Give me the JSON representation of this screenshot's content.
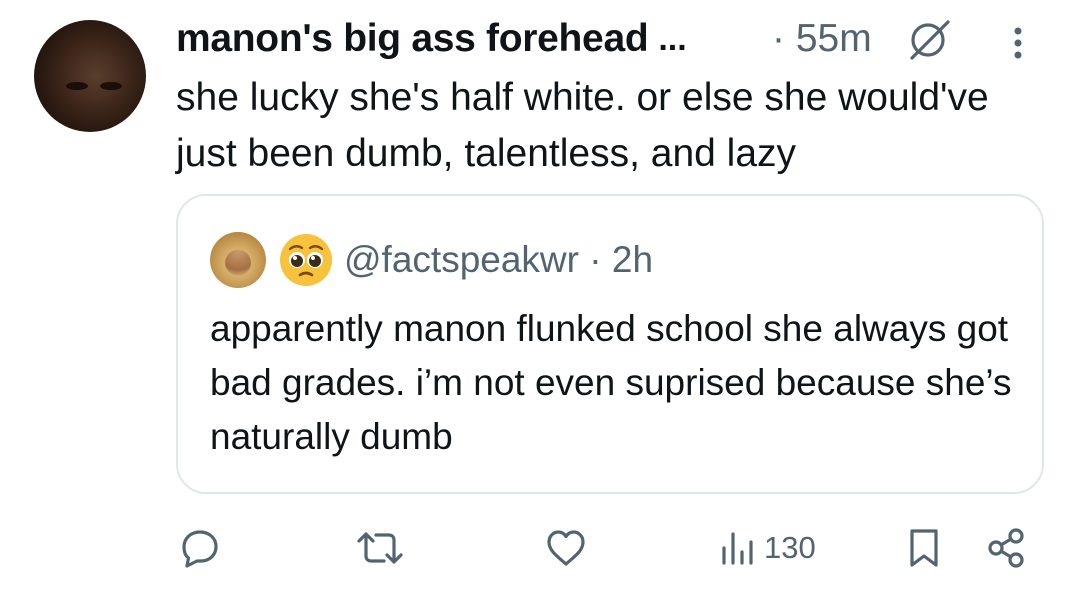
{
  "tweet": {
    "author_name": "manon's big ass forehead",
    "name_truncation": "...",
    "time": "· 55m",
    "text": "she lucky she's half white. or else she would've just been dumb, talentless, and lazy"
  },
  "quoted": {
    "handle": "@factspeakwr",
    "time": "· 2h",
    "text": "apparently manon flunked school she always got bad grades. i’m not even suprised because she’s naturally dumb"
  },
  "actions": {
    "views": "130"
  },
  "icons": {
    "grok": "grok-icon",
    "more": "more-vertical-icon",
    "reply": "reply-icon",
    "retweet": "retweet-icon",
    "like": "heart-icon",
    "views": "analytics-icon",
    "bookmark": "bookmark-icon",
    "share": "share-icon",
    "pleading_emoji": "pleading-face-emoji"
  },
  "colors": {
    "text": "#0f1419",
    "secondary": "#536471",
    "border": "#e1e6ea"
  }
}
